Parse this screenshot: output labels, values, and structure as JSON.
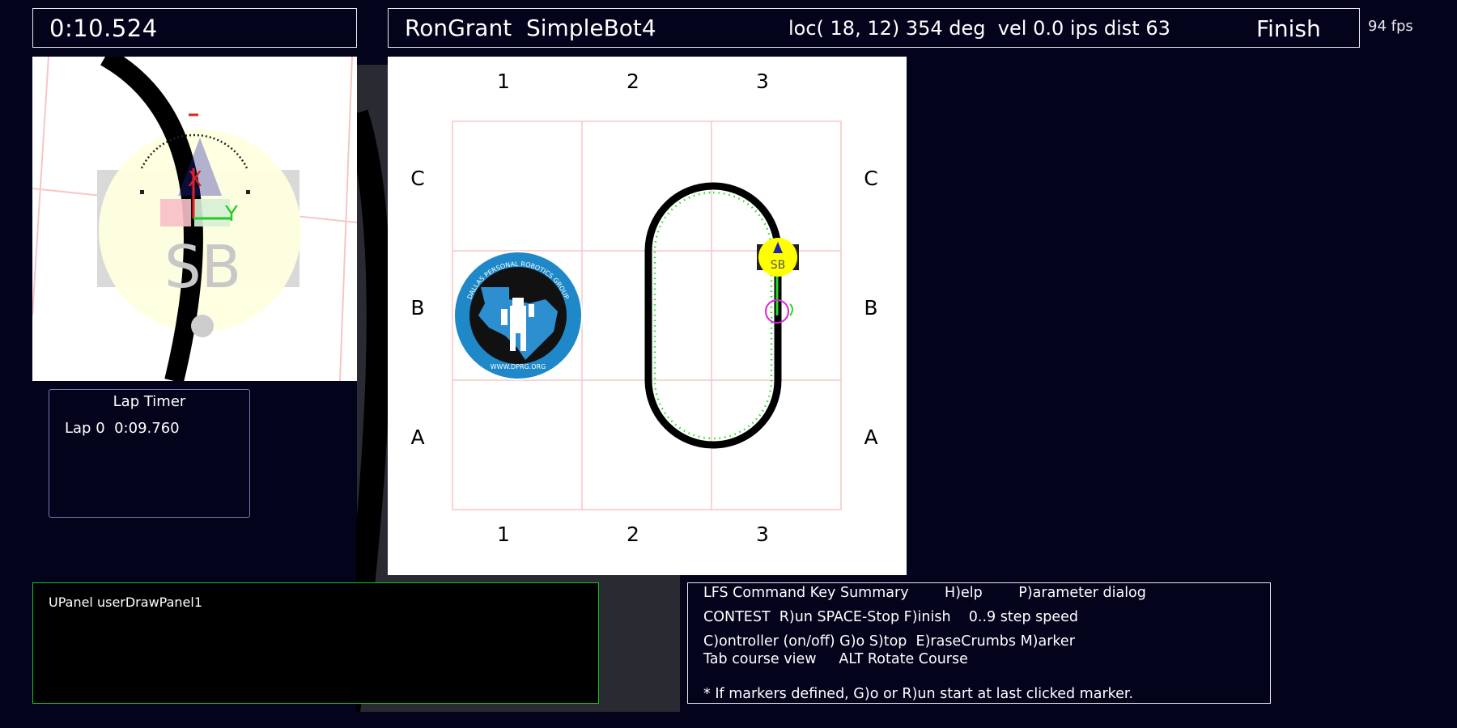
{
  "timer": {
    "elapsed": "0:10.524"
  },
  "status": {
    "robot_name": "RonGrant  SimpleBot4",
    "telemetry": "loc( 18, 12) 354 deg  vel 0.0 ips dist 63",
    "finish_label": "Finish"
  },
  "fps": "94 fps",
  "sensor_view": {
    "axis_x_label": "X",
    "axis_y_label": "Y",
    "robot_initials": "SB"
  },
  "lap_timer": {
    "title": "Lap Timer",
    "laps": [
      "Lap 0  0:09.760"
    ]
  },
  "course": {
    "columns": [
      "1",
      "2",
      "3"
    ],
    "rows": [
      "C",
      "B",
      "A"
    ],
    "robot_initials": "SB",
    "logo_text": "DALLAS PERSONAL ROBOTICS GROUP",
    "logo_url_text": "WWW.DPRG.ORG"
  },
  "user_panel": {
    "label": "UPanel userDrawPanel1"
  },
  "help": {
    "lines": [
      "LFS Command Key Summary        H)elp        P)arameter dialog",
      "CONTEST  R)un SPACE-Stop F)inish    0..9 step speed",
      "C)ontroller (on/off) G)o S)top  E)raseCrumbs M)arker",
      "Tab course view     ALT Rotate Course",
      "* If markers defined, G)o or R)un start at last clicked marker."
    ]
  },
  "colors": {
    "background": "#03031c",
    "track": "#000000",
    "grid": "#f6c6c6",
    "robot": "#ffff00",
    "crumbs": "#22dd22",
    "marker": "#dd22dd"
  }
}
